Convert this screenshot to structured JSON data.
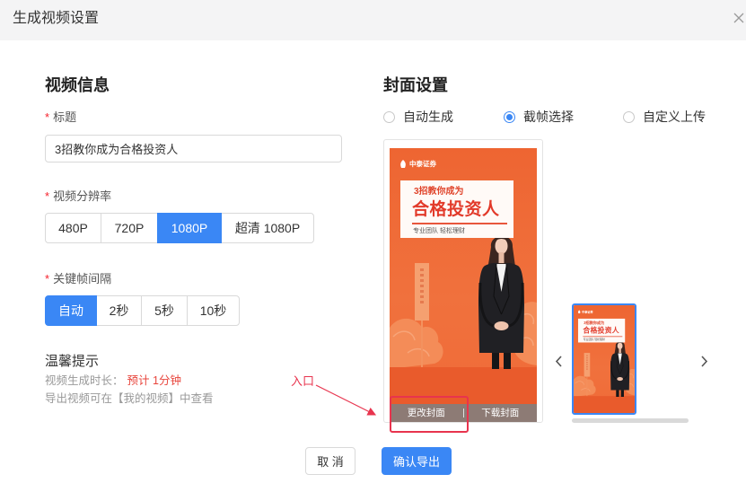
{
  "dialog": {
    "title": "生成视频设置",
    "close_icon": "close-icon"
  },
  "video_info": {
    "heading": "视频信息",
    "required_mark": "*",
    "title_label": "标题",
    "title_value": "3招教你成为合格投资人",
    "resolution_label": "视频分辨率",
    "resolutions": [
      "480P",
      "720P",
      "1080P",
      "超清 1080P"
    ],
    "resolution_selected_index": 2,
    "keyframe_label": "关键帧间隔",
    "keyframes": [
      "自动",
      "2秒",
      "5秒",
      "10秒"
    ],
    "keyframe_selected_index": 0,
    "tips_heading": "温馨提示",
    "duration_label": "视频生成时长：",
    "duration_value": "预计 1分钟",
    "export_hint": "导出视频可在【我的视频】中查看"
  },
  "cover": {
    "heading": "封面设置",
    "options": [
      "自动生成",
      "截帧选择",
      "自定义上传"
    ],
    "selected_index": 1,
    "change_label": "更改封面",
    "download_label": "下载封面",
    "prev_icon": "chevron-left-icon",
    "next_icon": "chevron-right-icon"
  },
  "poster": {
    "logo_text": "中泰证券",
    "line1": "3招教你成为",
    "line2": "合格投资人",
    "tagline": "专业团队 轻松理财"
  },
  "annotation": {
    "label": "入口"
  },
  "footer": {
    "cancel_label": "取 消",
    "confirm_label": "确认导出"
  },
  "colors": {
    "primary": "#3a87f5",
    "required": "#f5222d",
    "highlight": "#e8344e",
    "duration_value": "#e8453c",
    "poster_orange": "#ef6b37"
  }
}
